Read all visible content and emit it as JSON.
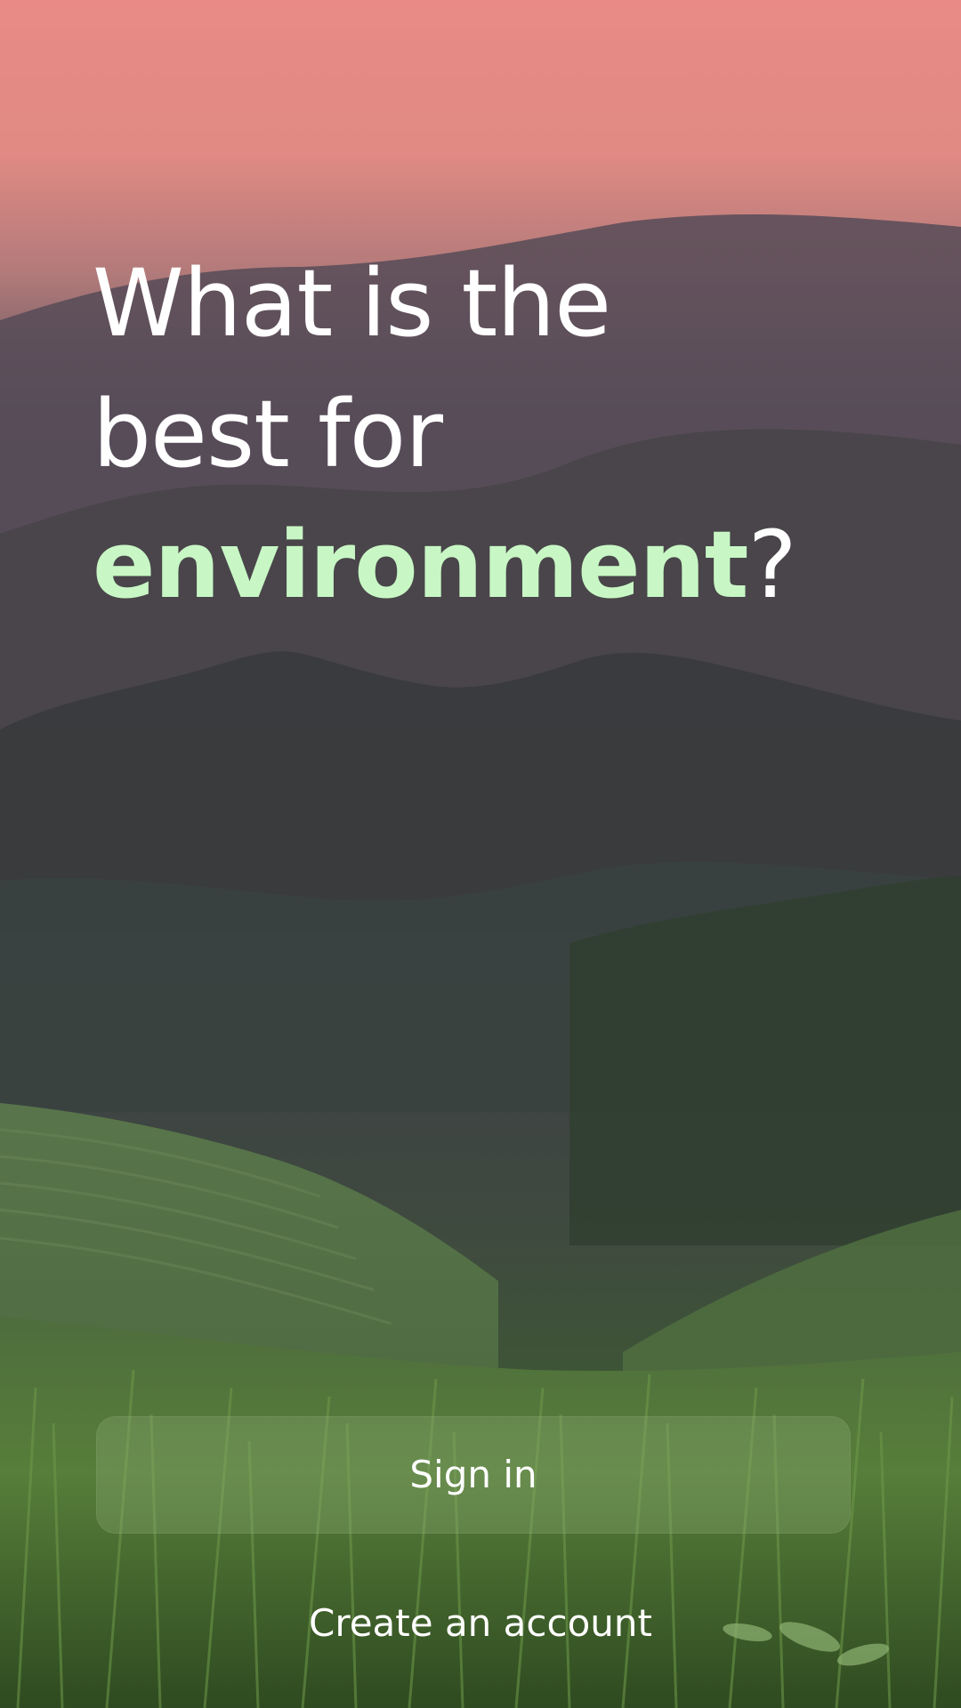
{
  "colors": {
    "accent": "#c8f7c5",
    "text": "#ffffff",
    "sky_top": "#e98a86",
    "grass": "#4f7a37"
  },
  "hero": {
    "line1": "What is the",
    "line2": "best for",
    "accent_word": "environment",
    "punctuation": "?"
  },
  "actions": {
    "signin_label": "Sign in",
    "create_account_label": "Create an account"
  }
}
